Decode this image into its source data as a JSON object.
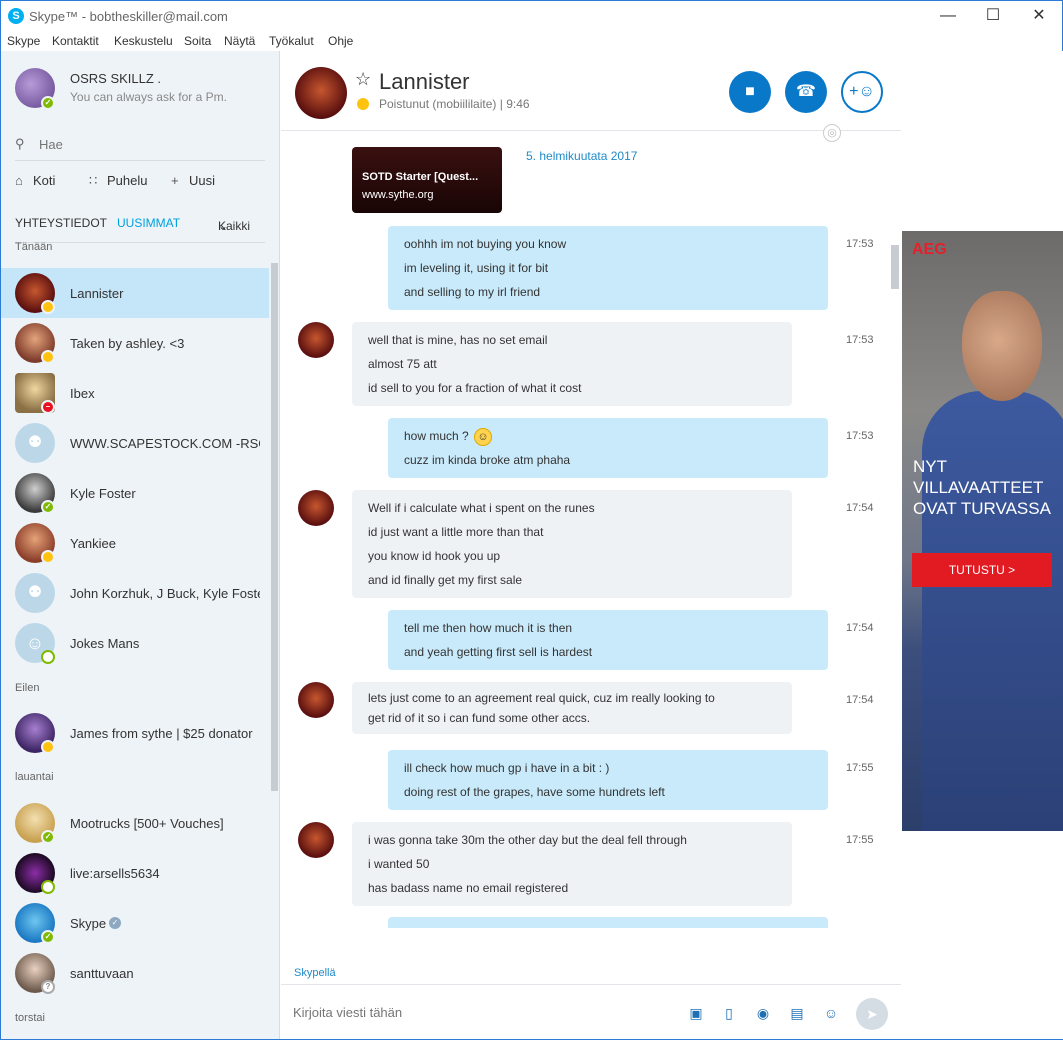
{
  "window": {
    "title": "Skype™ - bobtheskiller@mail.com",
    "skype_logo": "S",
    "minimize": "—",
    "maximize": "☐",
    "close": "✕"
  },
  "menu": [
    "Skype",
    "Kontaktit",
    "Keskustelu",
    "Soita",
    "Näytä",
    "Työkalut",
    "Ohje"
  ],
  "profile": {
    "name": "OSRS SKILLZ .",
    "mood": "You can always ask for a Pm."
  },
  "search": {
    "placeholder": "Hae",
    "icon": "search-icon"
  },
  "nav": {
    "home": "Koti",
    "call": "Puhelu",
    "new": "Uusi"
  },
  "tabs": {
    "contacts": "YHTEYSTIEDOT",
    "recent": "UUSIMMAT",
    "filter": "Kaikki"
  },
  "sections": {
    "today": "Tänään",
    "yesterday": "Eilen",
    "saturday": "lauantai",
    "thursday": "torstai"
  },
  "contacts": [
    {
      "name": "Lannister",
      "status": "away"
    },
    {
      "name": "Taken by ashley. <3",
      "status": "away"
    },
    {
      "name": "Ibex",
      "status": "dnd"
    },
    {
      "name": "WWW.SCAPESTOCK.COM -RSGP Trusted",
      "status": "group"
    },
    {
      "name": "Kyle Foster",
      "status": "online"
    },
    {
      "name": "Yankiee",
      "status": "away"
    },
    {
      "name": "John Korzhuk, J Buck, Kyle Foster",
      "status": "group"
    },
    {
      "name": "Jokes Mans",
      "status": "offline"
    },
    {
      "name": "James from sythe | $25 donator",
      "status": "away"
    },
    {
      "name": "Mootrucks [500+ Vouches]",
      "status": "online"
    },
    {
      "name": "live:arsells5634",
      "status": "offline"
    },
    {
      "name": "Skype",
      "status": "online"
    },
    {
      "name": "santtuvaan",
      "status": "unknown"
    }
  ],
  "chat": {
    "name": "Lannister",
    "status_text": "Poistunut (mobiililaite)",
    "separator": "|",
    "local_time": "9:46",
    "date_separator": "5. helmikuutata 2017",
    "link_card": {
      "title": "SOTD Starter [Quest...",
      "domain": "www.sythe.org"
    },
    "messages": [
      {
        "dir": "out",
        "time": "17:53",
        "lines": [
          "oohhh im not buying you know",
          "im leveling it, using it for bit",
          "and selling to my irl friend"
        ]
      },
      {
        "dir": "in",
        "time": "17:53",
        "lines": [
          "well that is mine, has no set email",
          "almost 75 att",
          "id sell to you for a fraction of what it cost"
        ]
      },
      {
        "dir": "out",
        "time": "17:53",
        "lines": [
          "how much ?",
          "cuzz im kinda broke atm phaha"
        ]
      },
      {
        "dir": "in",
        "time": "17:54",
        "lines": [
          "Well if i calculate what i spent on the runes",
          "id just want a little more than that",
          "you know id hook you up",
          "and id finally get my first sale"
        ]
      },
      {
        "dir": "out",
        "time": "17:54",
        "lines": [
          "tell me then how much it is then",
          "and yeah getting first sell is hardest"
        ]
      },
      {
        "dir": "in",
        "time": "17:54",
        "lines": [
          "lets just come to an agreement real quick, cuz im really looking to",
          "get rid of it so i can fund some other accs."
        ]
      },
      {
        "dir": "out",
        "time": "17:55",
        "lines": [
          "ill check how much gp i have in a bit : )",
          "doing rest of the grapes, have some hundrets left"
        ]
      },
      {
        "dir": "in",
        "time": "17:55",
        "lines": [
          "i was gonna take 30m the other day but the deal fell through",
          "i wanted 50",
          "has badass name no email registered"
        ]
      }
    ],
    "composer_label": "Skypellä",
    "composer_placeholder": "Kirjoita viesti tähän"
  },
  "ad": {
    "brand": "AEG",
    "headline": [
      "NYT",
      "VILLAVAATTEET",
      "OVAT TURVASSA"
    ],
    "cta": "TUTUSTU >"
  },
  "colors": {
    "accent": "#0a78c8",
    "outgoing_bubble": "#c9eafa",
    "incoming_bubble": "#eff2f5",
    "sidebar_bg": "#eef3f8",
    "selected": "#c5e6f8"
  }
}
